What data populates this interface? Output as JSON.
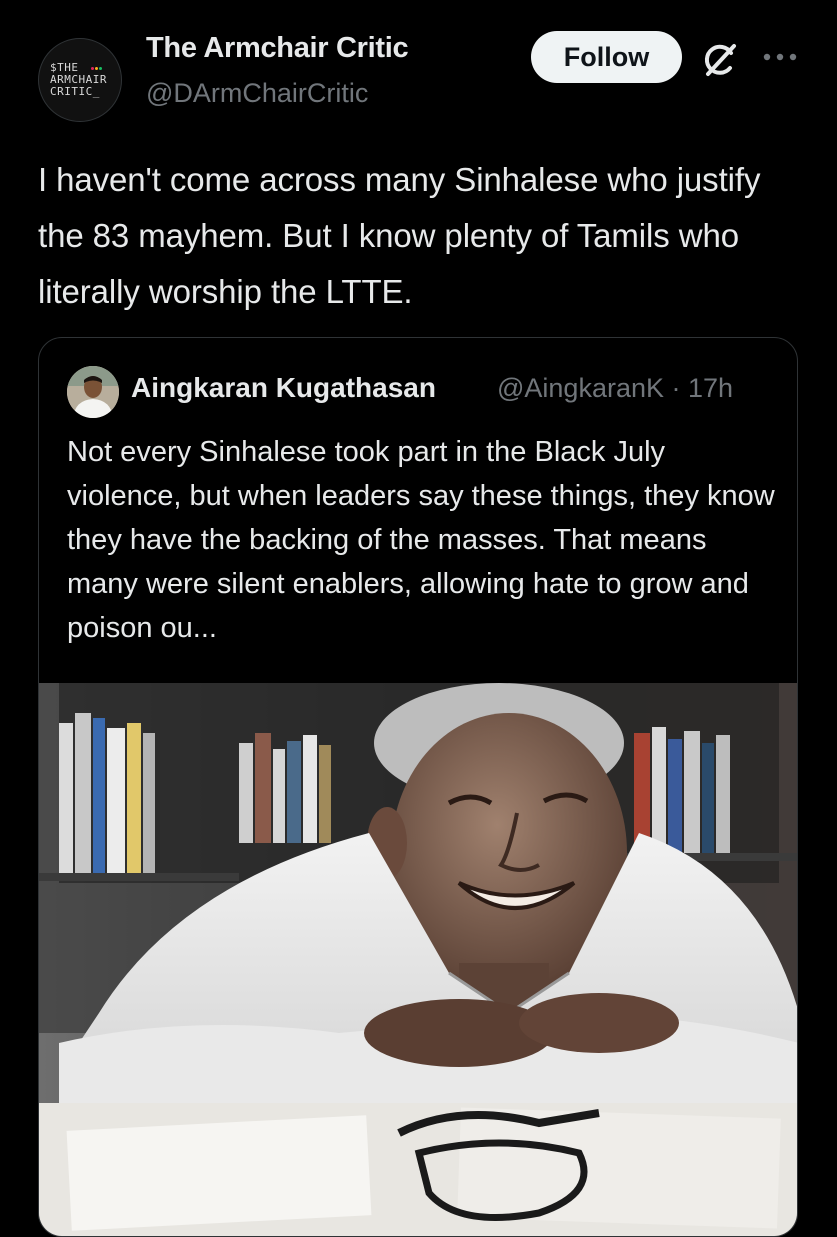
{
  "author": {
    "avatar_text": [
      "$THE",
      "ARMCHAIR",
      "CRITIC_"
    ],
    "display_name": "The Armchair Critic",
    "handle": "@DArmChairCritic",
    "follow_label": "Follow"
  },
  "icons": {
    "grok": "grok-icon",
    "more": "more-dots-icon"
  },
  "tweet": {
    "text": "I haven't come across many Sinhalese who justify the 83 mayhem. But I know plenty of Tamils who literally worship the LTTE."
  },
  "quoted": {
    "display_name": "Aingkaran Kugathasan",
    "meta": "@AingkaranK · 17h",
    "text": "Not every Sinhalese took part in the Black July violence, but when leaders say these things, they know they have the backing of the masses. That means many were silent enablers, allowing hate to grow and poison ou..."
  },
  "colors": {
    "background": "#000000",
    "text_primary": "#e7e9ea",
    "text_secondary": "#71767b",
    "border": "#2f3336",
    "follow_bg": "#eff3f4"
  }
}
